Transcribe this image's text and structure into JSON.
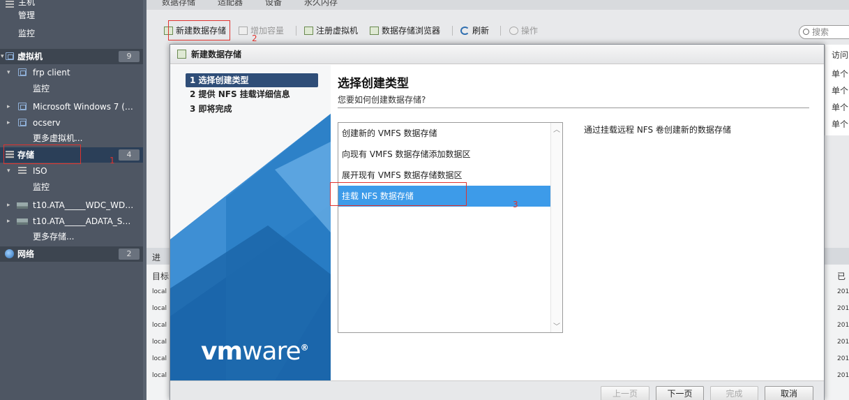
{
  "navigator": {
    "top_partial": "主机",
    "host_items": [
      "管理",
      "监控"
    ],
    "vm_section": {
      "label": "虚拟机",
      "count": "9"
    },
    "vms": [
      {
        "label": "frp client"
      },
      {
        "label": "监控"
      },
      {
        "label": "Microsoft Windows 7 (…"
      },
      {
        "label": "ocserv"
      },
      {
        "label": "更多虚拟机..."
      }
    ],
    "storage_section": {
      "label": "存储",
      "count": "4"
    },
    "storage_items": [
      {
        "label": "ISO"
      },
      {
        "label": "监控"
      },
      {
        "label": "t10.ATA_____WDC_WD…"
      },
      {
        "label": "t10.ATA_____ADATA_S…"
      },
      {
        "label": "更多存储..."
      }
    ],
    "network_section": {
      "label": "网络",
      "count": "2"
    }
  },
  "background": {
    "tabs": [
      "数据存储",
      "适配器",
      "设备",
      "永久内存"
    ],
    "toolbar": {
      "new_datastore": "新建数据存储",
      "increase_capacity": "增加容量",
      "register_vm": "注册虚拟机",
      "datastore_browser": "数据存储浏览器",
      "refresh": "刷新",
      "actions": "操作"
    },
    "search_placeholder": "搜索",
    "right_col_header": "访问",
    "right_col_values": [
      "单个",
      "单个",
      "单个",
      "单个"
    ],
    "lower_header_left": "目标",
    "lower_header_right": "已",
    "lower_title_partial": "进",
    "lower_rows_left": [
      "local",
      "local",
      "local",
      "local",
      "local",
      "local"
    ],
    "lower_rows_right": [
      "201",
      "201",
      "201",
      "201",
      "201",
      "201"
    ]
  },
  "dialog": {
    "title": "新建数据存储",
    "steps": [
      "1 选择创建类型",
      "2 提供 NFS 挂载详细信息",
      "3 即将完成"
    ],
    "logo": {
      "bold": "vm",
      "light": "ware",
      "mark": "®"
    },
    "page_title": "选择创建类型",
    "page_subtitle": "您要如何创建数据存储?",
    "options": [
      "创建新的 VMFS 数据存储",
      "向现有 VMFS 数据存储添加数据区",
      "展开现有 VMFS 数据存储数据区",
      "挂载 NFS 数据存储"
    ],
    "selected_option": "挂载 NFS 数据存储",
    "description": "通过挂载远程 NFS 卷创建新的数据存储",
    "buttons": {
      "back": "上一页",
      "next": "下一页",
      "finish": "完成",
      "cancel": "取消"
    }
  },
  "annotations": [
    "1",
    "2",
    "3"
  ],
  "colors": {
    "nav_bg": "#4e5663",
    "selected_step": "#2f4e78",
    "selected_option": "#3d9be9",
    "annotation_red": "#e0332e"
  }
}
